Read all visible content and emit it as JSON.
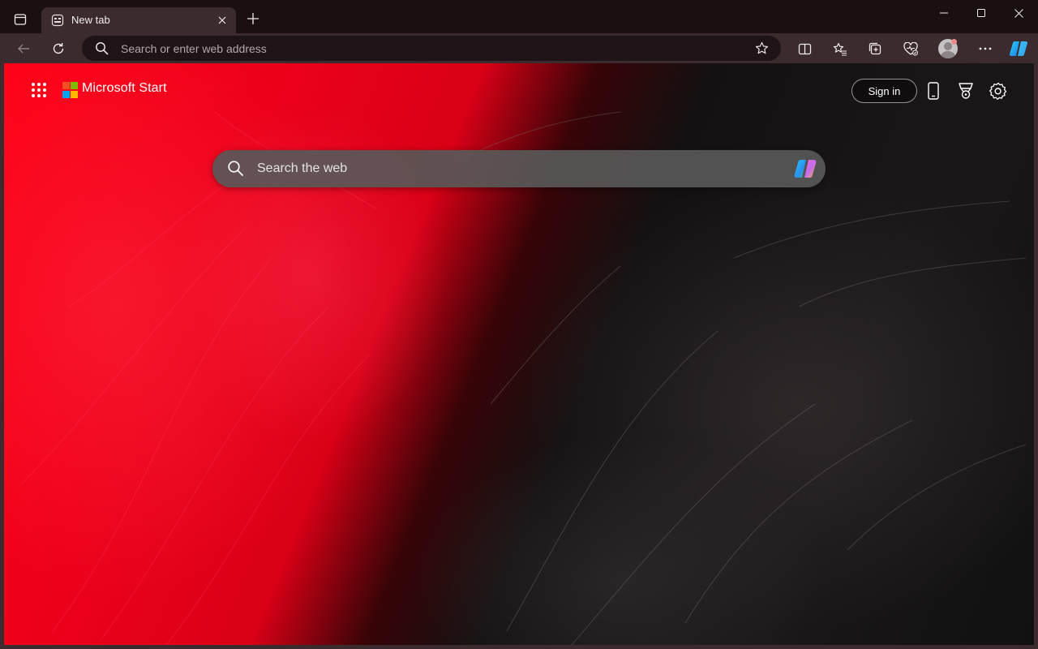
{
  "browser": {
    "tab": {
      "title": "New tab"
    },
    "address_bar": {
      "placeholder": "Search or enter web address"
    }
  },
  "page": {
    "brand": "Microsoft Start",
    "sign_in_label": "Sign in",
    "search": {
      "placeholder": "Search the web"
    }
  },
  "colors": {
    "titlebar": "#1a1012",
    "toolbar": "#3b2a2e",
    "background_red": "#ff0016",
    "background_black": "#141112",
    "ms_logo": [
      "#f25022",
      "#7fba00",
      "#00a4ef",
      "#ffb900"
    ]
  },
  "icons": {
    "window": [
      "sidebar-toggle-icon",
      "new-tab-page-icon",
      "close-icon",
      "plus-icon",
      "minimize-icon",
      "maximize-icon",
      "window-close-icon"
    ],
    "toolbar": [
      "back-arrow-icon",
      "refresh-icon",
      "search-icon",
      "star-icon",
      "split-screen-icon",
      "favorites-icon",
      "collections-icon",
      "browser-essentials-icon",
      "profile-avatar",
      "more-icon",
      "copilot-icon"
    ],
    "page": [
      "apps-grid-icon",
      "microsoft-logo",
      "phone-icon",
      "rewards-trophy-icon",
      "settings-gear-icon",
      "search-icon",
      "copilot-icon"
    ]
  }
}
